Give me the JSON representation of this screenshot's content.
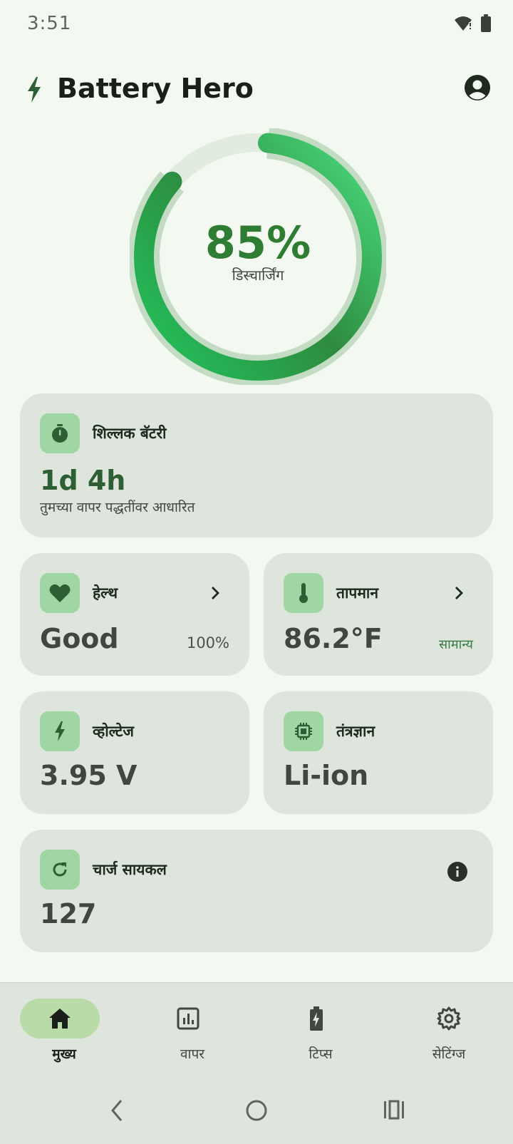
{
  "status_bar": {
    "time": "3:51"
  },
  "app": {
    "title": "Battery Hero"
  },
  "battery": {
    "percent": "85%",
    "level": 0.85,
    "status": "डिस्चार्जिंग"
  },
  "remaining": {
    "title": "शिल्लक बॅटरी",
    "value": "1d 4h",
    "note": "तुमच्या वापर पद्धतींवर आधारित"
  },
  "health": {
    "title": "हेल्थ",
    "value": "Good",
    "percent": "100%"
  },
  "temperature": {
    "title": "तापमान",
    "value": "86.2°F",
    "status": "सामान्य"
  },
  "voltage": {
    "title": "व्होल्टेज",
    "value": "3.95 V"
  },
  "technology": {
    "title": "तंत्रज्ञान",
    "value": "Li-ion"
  },
  "cycles": {
    "title": "चार्ज सायकल",
    "value": "127"
  },
  "nav": {
    "items": [
      {
        "label": "मुख्य",
        "icon": "home-icon",
        "active": true
      },
      {
        "label": "वापर",
        "icon": "usage-chart-icon",
        "active": false
      },
      {
        "label": "टिप्स",
        "icon": "battery-charging-icon",
        "active": false
      },
      {
        "label": "सेटिंग्ज",
        "icon": "gear-icon",
        "active": false
      }
    ]
  },
  "colors": {
    "accent": "#2e7d32",
    "ring_light": "#22c55e",
    "background": "#f3f8f1",
    "card": "#dee5dc",
    "chip": "#9fd6a4",
    "nav_active": "#b9dba7"
  }
}
